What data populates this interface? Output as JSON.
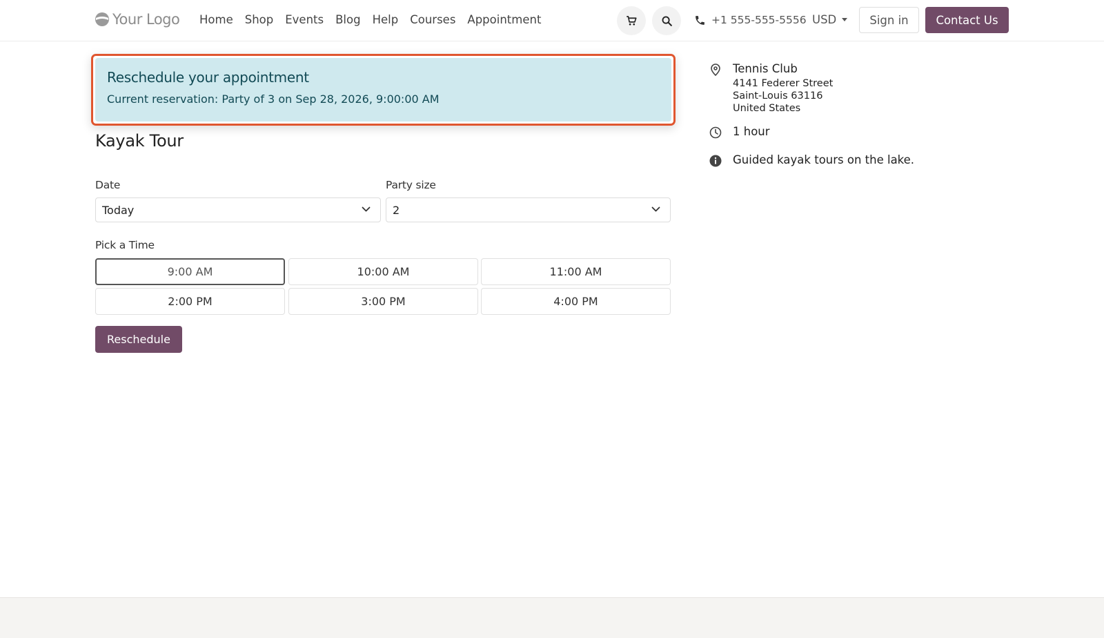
{
  "header": {
    "logo_text": "Your Logo",
    "nav": [
      "Home",
      "Shop",
      "Events",
      "Blog",
      "Help",
      "Courses",
      "Appointment"
    ],
    "phone": "+1 555-555-5556",
    "currency": "USD",
    "sign_in": "Sign in",
    "contact": "Contact Us"
  },
  "alert": {
    "title": "Reschedule your appointment",
    "text": "Current reservation: Party of 3 on Sep 28, 2026, 9:00:00 AM",
    "highlight_color": "#e0562f",
    "bg_color": "#cfe9ee"
  },
  "main": {
    "title": "Kayak Tour",
    "date_label": "Date",
    "date_value": "Today",
    "party_label": "Party size",
    "party_value": "2",
    "time_label": "Pick a Time",
    "times": [
      "9:00 AM",
      "10:00 AM",
      "11:00 AM",
      "2:00 PM",
      "3:00 PM",
      "4:00 PM"
    ],
    "selected_time": "9:00 AM",
    "submit": "Reschedule"
  },
  "sidebar": {
    "location_name": "Tennis Club",
    "address": [
      "4141 Federer Street",
      "Saint-Louis 63116",
      "United States"
    ],
    "duration": "1 hour",
    "description": "Guided kayak tours on the lake."
  },
  "colors": {
    "brand": "#714b67"
  },
  "icons": [
    "cart-icon",
    "search-icon",
    "phone-icon",
    "chevron-down-icon",
    "map-pin-icon",
    "clock-icon",
    "info-icon"
  ]
}
